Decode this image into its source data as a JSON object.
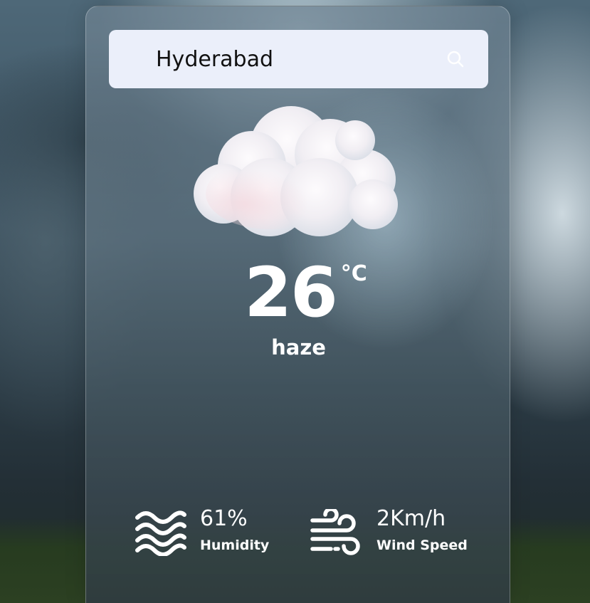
{
  "search": {
    "value": "Hyderabad",
    "icon": "search-icon"
  },
  "weather": {
    "icon": "cloud-icon",
    "temperature": "26",
    "unit": "°C",
    "condition": "haze"
  },
  "stats": {
    "humidity": {
      "value": "61%",
      "label": "Humidity",
      "icon": "waves-icon"
    },
    "wind": {
      "value": "2Km/h",
      "label": "Wind Speed",
      "icon": "wind-icon"
    }
  },
  "colors": {
    "search_bg": "#ebeffa",
    "text": "#ffffff"
  }
}
